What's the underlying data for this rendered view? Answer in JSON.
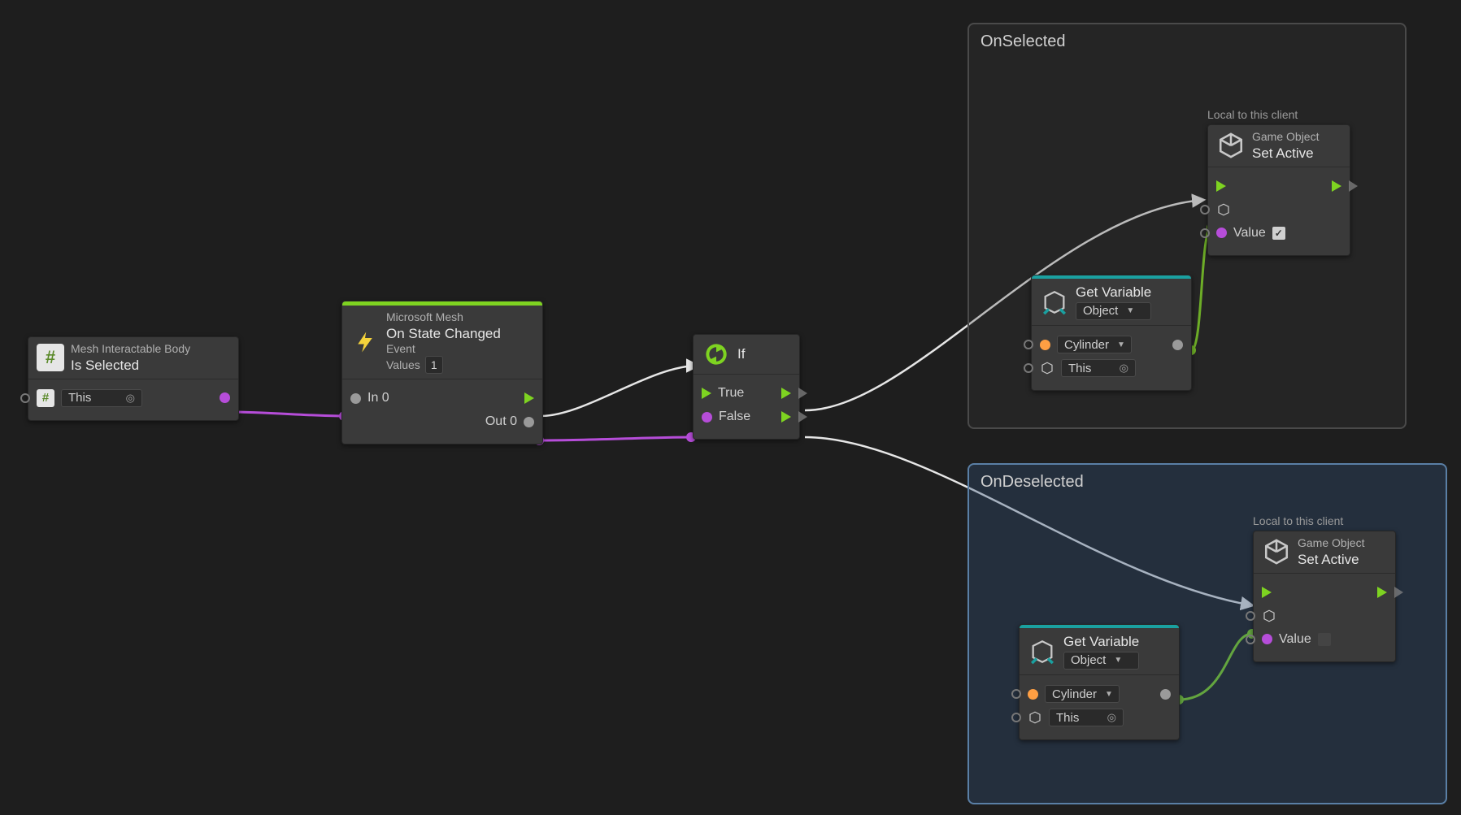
{
  "colors": {
    "accent_green": "#7ed321",
    "accent_teal": "#1aa0a0",
    "purple": "#b64dd9",
    "orange": "#ff9f43"
  },
  "groups": {
    "onSelected": {
      "title": "OnSelected"
    },
    "onDeselected": {
      "title": "OnDeselected"
    }
  },
  "node_isSelected": {
    "subtitle": "Mesh Interactable Body",
    "title": "Is Selected",
    "target_field": "This"
  },
  "node_onStateChanged": {
    "category": "Microsoft Mesh",
    "title": "On State Changed",
    "event_label": "Event",
    "values_label": "Values",
    "values_value": "1",
    "in_label": "In 0",
    "out_label": "Out 0"
  },
  "node_if": {
    "title": "If",
    "true_label": "True",
    "false_label": "False"
  },
  "node_setActive_selected": {
    "local_label": "Local to this client",
    "subtitle": "Game Object",
    "title": "Set Active",
    "value_label": "Value",
    "value_checked": true
  },
  "node_getVar_selected": {
    "title": "Get Variable",
    "scope": "Object",
    "var_name": "Cylinder",
    "target": "This"
  },
  "node_setActive_deselected": {
    "local_label": "Local to this client",
    "subtitle": "Game Object",
    "title": "Set Active",
    "value_label": "Value",
    "value_checked": false
  },
  "node_getVar_deselected": {
    "title": "Get Variable",
    "scope": "Object",
    "var_name": "Cylinder",
    "target": "This"
  }
}
